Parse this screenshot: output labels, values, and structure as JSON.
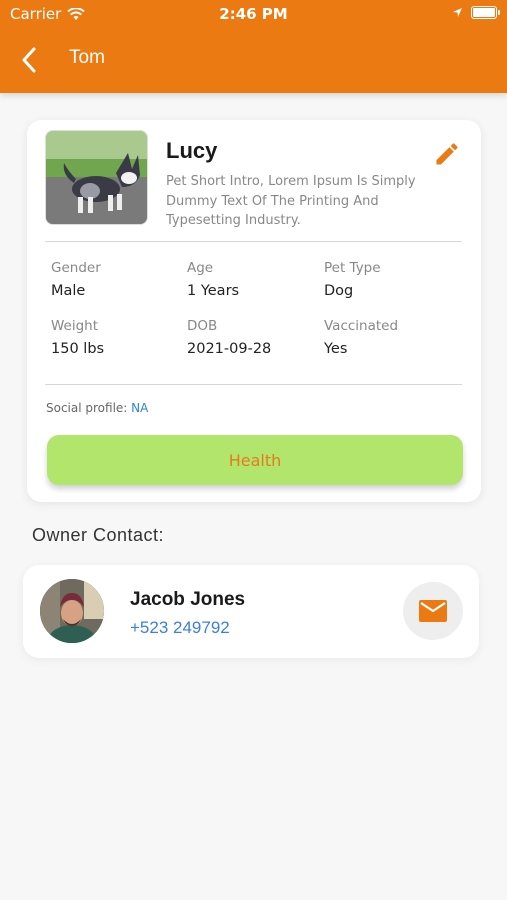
{
  "status_bar": {
    "carrier": "Carrier",
    "time": "2:46 PM"
  },
  "nav": {
    "title": "Tom"
  },
  "pet": {
    "name": "Lucy",
    "intro": "Pet Short Intro, Lorem Ipsum Is Simply Dummy Text Of The Printing And Typesetting Industry.",
    "details": [
      {
        "label": "Gender",
        "value": "Male"
      },
      {
        "label": "Age",
        "value": "1 Years"
      },
      {
        "label": "Pet Type",
        "value": "Dog"
      },
      {
        "label": "Weight",
        "value": "150 lbs"
      },
      {
        "label": "DOB",
        "value": "2021-09-28"
      },
      {
        "label": "Vaccinated",
        "value": "Yes"
      }
    ],
    "social_label": "Social profile:",
    "social_value": "NA",
    "health_label": "Health"
  },
  "owner": {
    "section_title": "Owner Contact:",
    "name": "Jacob Jones",
    "phone": "+523 249792"
  },
  "colors": {
    "header": "#ec7a12",
    "accent": "#ec7a12",
    "health_button": "#b2e56c",
    "link": "#3a7fe0"
  }
}
